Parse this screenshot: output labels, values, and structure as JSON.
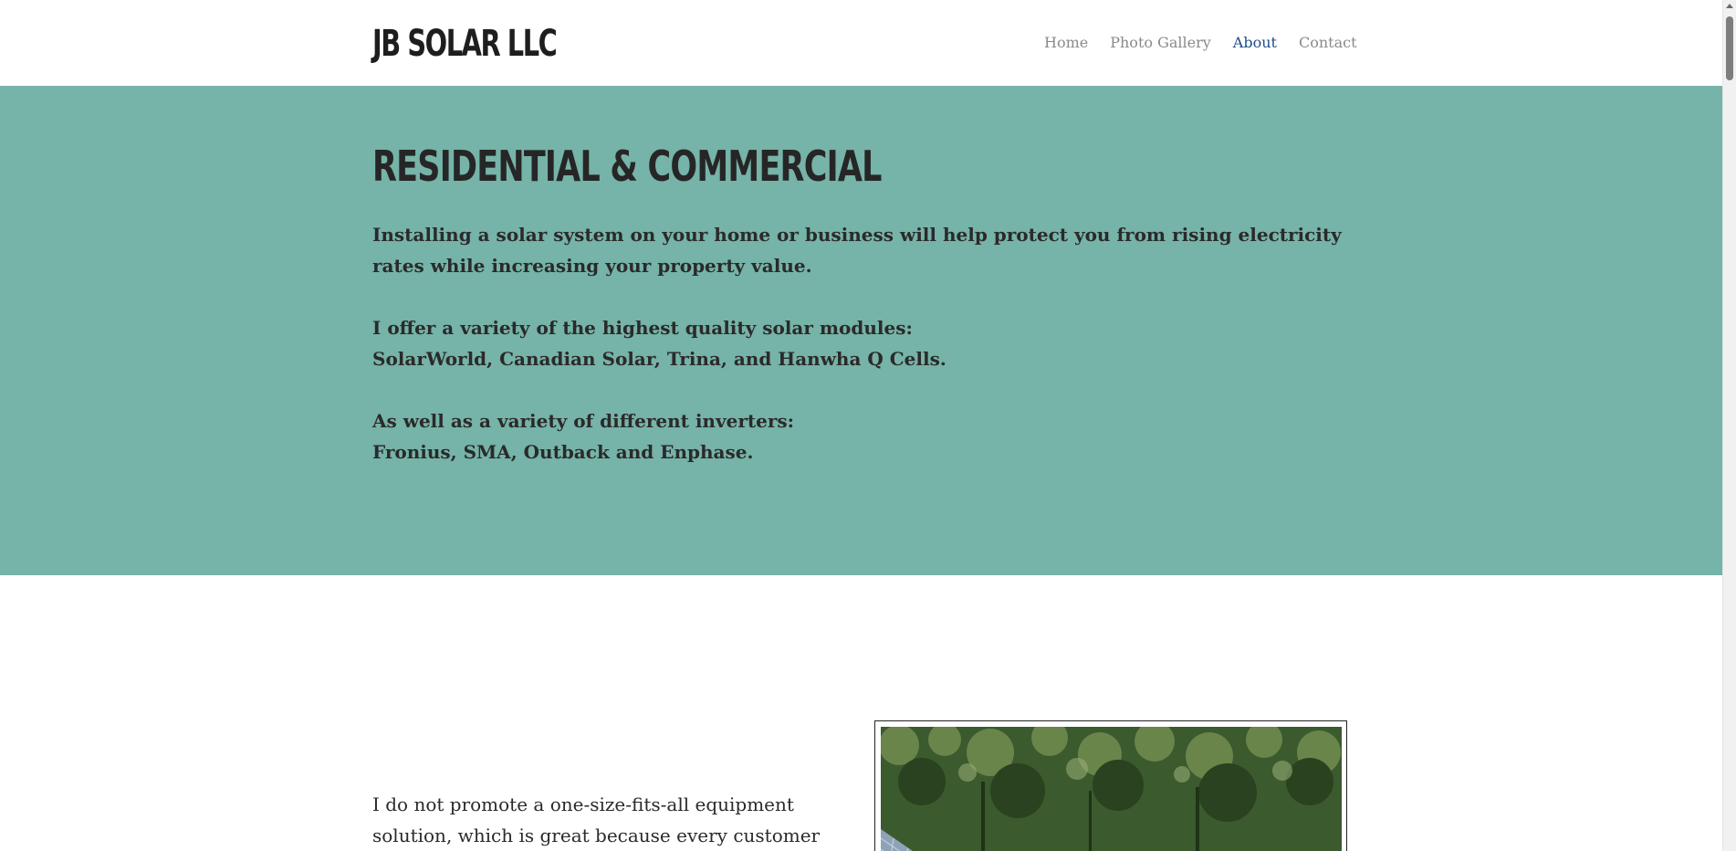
{
  "header": {
    "logo": "JB SOLAR LLC",
    "nav": [
      {
        "label": "Home",
        "active": false
      },
      {
        "label": "Photo Gallery",
        "active": false
      },
      {
        "label": "About",
        "active": true
      },
      {
        "label": "Contact",
        "active": false
      }
    ]
  },
  "hero": {
    "title": "RESIDENTIAL & COMMERCIAL",
    "paragraphs": [
      [
        "Installing a solar system on your home or business will help protect you from rising electricity rates while increasing your property value."
      ],
      [
        "I offer a variety of the highest quality solar modules:",
        "SolarWorld, Canadian Solar, Trina, and Hanwha Q Cells."
      ],
      [
        "As well as a variety of different inverters:",
        "Fronius, SMA, Outback and Enphase."
      ]
    ]
  },
  "section2": {
    "text": "I do not promote a one-size-fits-all equipment solution, which is great because every customer has"
  },
  "colors": {
    "hero_bg": "#76b3a8",
    "nav_active": "#1d4b8f",
    "nav_inactive": "#8a8a8a"
  }
}
